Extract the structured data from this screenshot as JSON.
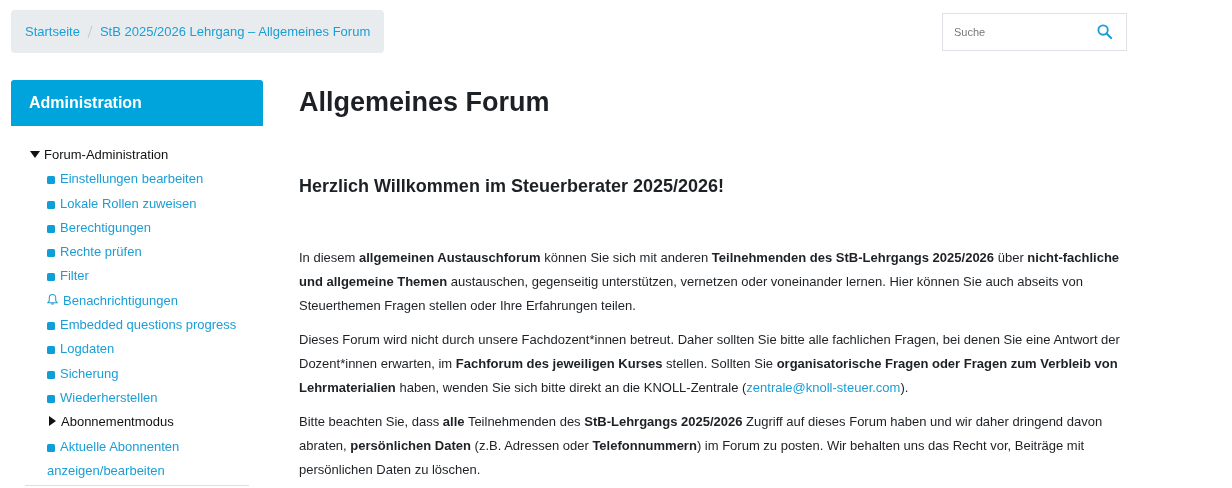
{
  "breadcrumb": [
    "Startseite",
    "StB 2025/2026 Lehrgang – Allgemeines Forum"
  ],
  "search": {
    "placeholder": "Suche"
  },
  "sidebar": {
    "title": "Administration",
    "items": [
      {
        "kind": "folder",
        "label": "Forum-Administration",
        "expanded": true,
        "children": [
          {
            "kind": "link",
            "label": "Einstellungen bearbeiten"
          },
          {
            "kind": "link",
            "label": "Lokale Rollen zuweisen"
          },
          {
            "kind": "link",
            "label": "Berechtigungen"
          },
          {
            "kind": "link",
            "label": "Rechte prüfen"
          },
          {
            "kind": "link",
            "label": "Filter"
          },
          {
            "kind": "bell-link",
            "label": "Benachrichtigungen"
          },
          {
            "kind": "link",
            "label": "Embedded questions progress"
          },
          {
            "kind": "link",
            "label": "Logdaten"
          },
          {
            "kind": "link",
            "label": "Sicherung"
          },
          {
            "kind": "link",
            "label": "Wiederherstellen"
          },
          {
            "kind": "folder",
            "label": "Abonnementmodus",
            "expanded": false
          },
          {
            "kind": "link",
            "label": "Aktuelle Abonnenten anzeigen/bearbeiten"
          }
        ]
      }
    ]
  },
  "title": "Allgemeines Forum",
  "subtitle": "Herzlich Willkommen im Steuerberater 2025/2026!",
  "paragraphs": [
    {
      "text": "In diesem **allgemeinen Austauschforum** können Sie sich mit anderen **Teilnehmenden des StB-Lehrgangs 2025/2026** über **nicht-fachliche und allgemeine Themen** austauschen, gegenseitig unterstützen, vernetzen oder voneinander lernen. Hier können Sie auch abseits von Steuerthemen Fragen stellen oder Ihre Erfahrungen teilen."
    },
    {
      "text": "Dieses Forum wird nicht durch unsere Fachdozent*innen betreut. Daher sollten Sie bitte alle fachlichen Fragen, bei denen Sie eine Antwort der Dozent*innen erwarten, im **Fachforum des jeweiligen Kurses** stellen. Sollten Sie **organisatorische Fragen oder Fragen zum Verbleib von Lehrmaterialien** haben, wenden Sie sich bitte direkt an die KNOLL-Zentrale (",
      "link": "zentrale@knoll-steuer.com",
      "after": ")."
    },
    {
      "text": "Bitte beachten Sie, dass **alle** Teilnehmenden des **StB-Lehrgangs 2025/2026** Zugriff auf dieses Forum haben und wir daher dringend davon abraten,  **persönlichen Daten** (z.B. Adressen oder **Telefonnummern**) im Forum zu posten. Wir behalten uns das Recht vor, Beiträge mit persönlichen Daten zu löschen."
    }
  ]
}
